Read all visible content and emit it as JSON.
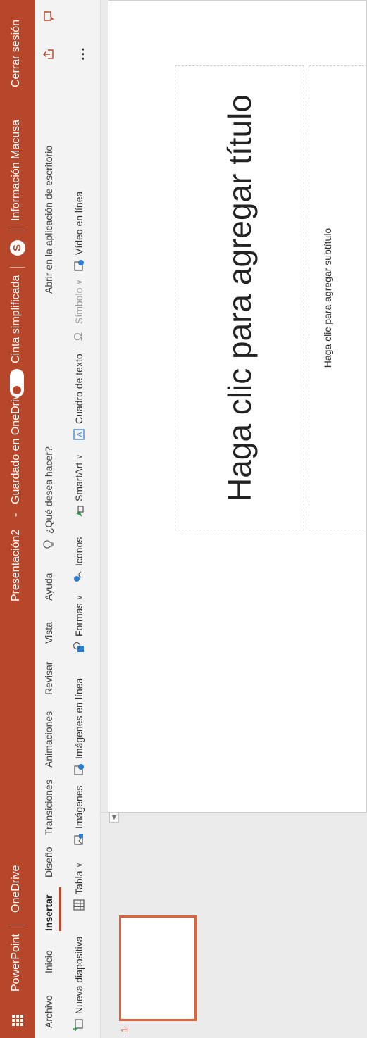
{
  "titlebar": {
    "app_name": "PowerPoint",
    "onedrive": "OneDrive",
    "doc_title": "Presentación2",
    "separator": "-",
    "save_status": "Guardado en OneDrive",
    "simplified_ribbon": "Cinta simplificada",
    "user_info": "Información Macusa",
    "sign_out": "Cerrar sesión"
  },
  "ribbon": {
    "tabs": [
      {
        "label": "Archivo"
      },
      {
        "label": "Inicio"
      },
      {
        "label": "Insertar"
      },
      {
        "label": "Diseño"
      },
      {
        "label": "Transiciones"
      },
      {
        "label": "Animaciones"
      },
      {
        "label": "Revisar"
      },
      {
        "label": "Vista"
      },
      {
        "label": "Ayuda"
      }
    ],
    "active_tab": "Insertar",
    "tell_me": "¿Qué desea hacer?",
    "open_desktop": "Abrir en la aplicación de escritorio",
    "commands": {
      "new_slide": "Nueva diapositiva",
      "table": "Tabla",
      "images": "Imágenes",
      "online_images": "Imágenes en línea",
      "shapes": "Formas",
      "icons": "Iconos",
      "smartart": "SmartArt",
      "textbox": "Cuadro de texto",
      "symbol": "Símbolo",
      "online_video": "Vídeo en línea"
    },
    "more": "..."
  },
  "thumbnails": [
    {
      "number": "1"
    }
  ],
  "slide": {
    "title_placeholder": "Haga clic para agregar título",
    "subtitle_placeholder": "Haga clic para agregar subtítulo"
  },
  "colors": {
    "accent": "#b7472a",
    "thumb_border": "#e0623b",
    "ribbon_bg": "#f3f3f3",
    "canvas_bg": "#ebebeb"
  },
  "icons": [
    "app-launcher-icon",
    "lightbulb-icon",
    "skype-icon",
    "share-icon",
    "comments-icon",
    "new-slide-icon",
    "table-icon",
    "pictures-icon",
    "online-pictures-icon",
    "shapes-icon",
    "icons-icon",
    "smartart-icon",
    "textbox-icon",
    "symbol-icon",
    "video-icon",
    "more-icon"
  ]
}
